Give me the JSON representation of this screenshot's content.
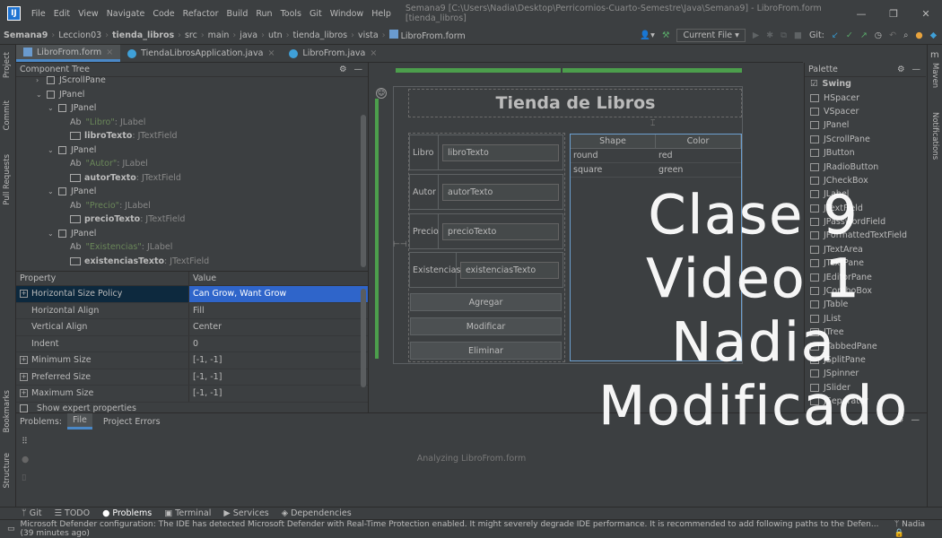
{
  "window": {
    "logo": "IJ",
    "menu": [
      "File",
      "Edit",
      "View",
      "Navigate",
      "Code",
      "Refactor",
      "Build",
      "Run",
      "Tools",
      "Git",
      "Window",
      "Help"
    ],
    "title": "Semana9 [C:\\Users\\Nadia\\Desktop\\Perricornios-Cuarto-Semestre\\Java\\Semana9] - LibroFrom.form [tienda_libros]",
    "controls": [
      "—",
      "❐",
      "✕"
    ]
  },
  "breadcrumbs": [
    "Semana9",
    "Leccion03",
    "tienda_libros",
    "src",
    "main",
    "java",
    "utn",
    "tienda_libros",
    "vista",
    "LibroFrom.form"
  ],
  "toolbar": {
    "run_config": "Current File",
    "git_label": "Git:"
  },
  "tabs": [
    {
      "label": "LibroFrom.form",
      "active": true
    },
    {
      "label": "TiendaLibrosApplication.java",
      "active": false
    },
    {
      "label": "LibroFrom.java",
      "active": false
    }
  ],
  "left_stripe": [
    "Project",
    "Commit",
    "Pull Requests",
    "Bookmarks",
    "Structure"
  ],
  "right_stripe": [
    "Maven",
    "Notifications"
  ],
  "component_tree": {
    "title": "Component Tree",
    "rows": [
      {
        "indent": 2,
        "arrow": "›",
        "type": "chk",
        "name": "JScrollPane",
        "cut": true
      },
      {
        "indent": 2,
        "arrow": "⌄",
        "type": "chk",
        "name": "JPanel"
      },
      {
        "indent": 3,
        "arrow": "⌄",
        "type": "chk",
        "name": "JPanel"
      },
      {
        "indent": 4,
        "arrow": "",
        "type": "label",
        "str": "\"Libro\"",
        "suffix": ": JLabel"
      },
      {
        "indent": 4,
        "arrow": "",
        "type": "field",
        "name": "libroTexto",
        "suffix": ": JTextField"
      },
      {
        "indent": 3,
        "arrow": "⌄",
        "type": "chk",
        "name": "JPanel"
      },
      {
        "indent": 4,
        "arrow": "",
        "type": "label",
        "str": "\"Autor\"",
        "suffix": ": JLabel"
      },
      {
        "indent": 4,
        "arrow": "",
        "type": "field",
        "name": "autorTexto",
        "suffix": ": JTextField"
      },
      {
        "indent": 3,
        "arrow": "⌄",
        "type": "chk",
        "name": "JPanel"
      },
      {
        "indent": 4,
        "arrow": "",
        "type": "label",
        "str": "\"Precio\"",
        "suffix": ": JLabel"
      },
      {
        "indent": 4,
        "arrow": "",
        "type": "field",
        "name": "precioTexto",
        "suffix": ": JTextField"
      },
      {
        "indent": 3,
        "arrow": "⌄",
        "type": "chk",
        "name": "JPanel"
      },
      {
        "indent": 4,
        "arrow": "",
        "type": "label",
        "str": "\"Existencias\"",
        "suffix": ": JLabel"
      },
      {
        "indent": 4,
        "arrow": "",
        "type": "field",
        "name": "existenciasTexto",
        "suffix": ": JTextField"
      }
    ]
  },
  "properties": {
    "col_property": "Property",
    "col_value": "Value",
    "rows": [
      {
        "name": "Horizontal Size Policy",
        "value": "Can Grow, Want Grow",
        "expand": true,
        "selected": true
      },
      {
        "name": "Horizontal Align",
        "value": "Fill",
        "expand": false
      },
      {
        "name": "Vertical Align",
        "value": "Center",
        "expand": false
      },
      {
        "name": "Indent",
        "value": "0",
        "expand": false
      },
      {
        "name": "Minimum Size",
        "value": "[-1, -1]",
        "expand": true
      },
      {
        "name": "Preferred Size",
        "value": "[-1, -1]",
        "expand": true
      },
      {
        "name": "Maximum Size",
        "value": "[-1, -1]",
        "expand": true
      }
    ],
    "show_expert": "Show expert properties"
  },
  "form": {
    "title": "Tienda de Libros",
    "fields": [
      {
        "label": "Libro",
        "value": "libroTexto"
      },
      {
        "label": "Autor",
        "value": "autorTexto"
      },
      {
        "label": "Precio",
        "value": "precioTexto"
      },
      {
        "label": "Existencias",
        "value": "existenciasTexto"
      }
    ],
    "buttons": [
      "Agregar",
      "Modificar",
      "Eliminar"
    ],
    "table": {
      "headers": [
        "Shape",
        "Color"
      ],
      "rows": [
        [
          "round",
          "red"
        ],
        [
          "square",
          "green"
        ]
      ]
    }
  },
  "palette": {
    "title": "Palette",
    "group": "Swing",
    "items": [
      "HSpacer",
      "VSpacer",
      "JPanel",
      "JScrollPane",
      "JButton",
      "JRadioButton",
      "JCheckBox",
      "JLabel",
      "JTextField",
      "JPasswordField",
      "JFormattedTextField",
      "JTextArea",
      "JTextPane",
      "JEditorPane",
      "JComboBox",
      "JTable",
      "JList",
      "JTree",
      "JTabbedPane",
      "JSplitPane",
      "JSpinner",
      "JSlider",
      "JSeparator"
    ]
  },
  "problems": {
    "title": "Problems:",
    "tabs": [
      "File",
      "Project Errors"
    ],
    "message": "Analyzing LibroFrom.form"
  },
  "tool_windows": [
    "Git",
    "TODO",
    "Problems",
    "Terminal",
    "Services",
    "Dependencies"
  ],
  "status": {
    "message": "Microsoft Defender configuration: The IDE has detected Microsoft Defender with Real-Time Protection enabled. It might severely degrade IDE performance. It is recommended to add following paths to the Defen... (39 minutes ago)",
    "user": "Nadia"
  },
  "overlay": [
    "Clase 9",
    "Video 1",
    "Nadia",
    "Modificado"
  ]
}
